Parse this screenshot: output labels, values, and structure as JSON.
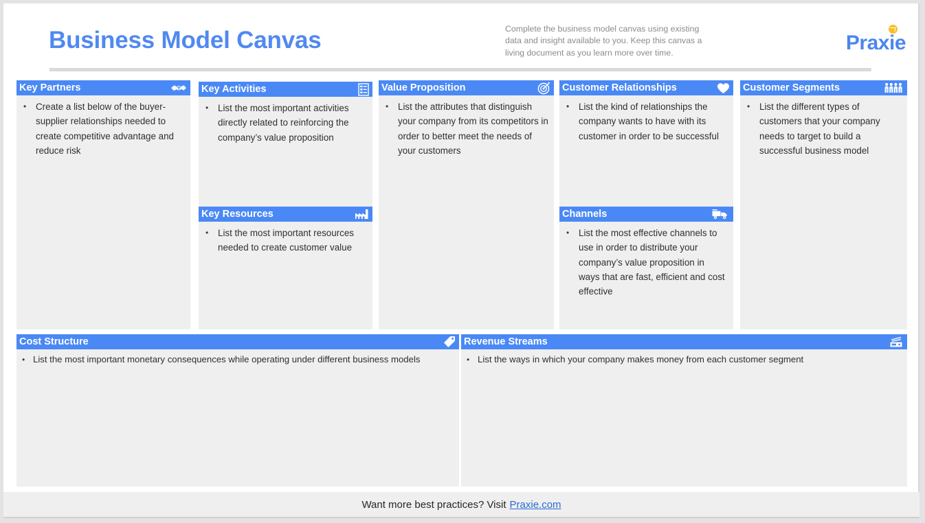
{
  "header": {
    "title": "Business Model Canvas",
    "subtitle": "Complete the business model canvas using existing data and insight available to you. Keep this canvas a living document as you learn more over time.",
    "brand_prefix": "Prax",
    "brand_i": "i",
    "brand_suffix": "e"
  },
  "colors": {
    "accent_blue": "#4a89f5",
    "title_blue": "#5089f0",
    "brand_blue": "#4c86ef",
    "brand_dot_orange": "#fbbf24",
    "panel_body_gray": "#efefef",
    "page_white": "#ffffff",
    "rule_gray": "#d9d9d9",
    "link_blue": "#2a6ad4"
  },
  "panels": [
    {
      "id": "key-partners",
      "title": "Key Partners",
      "icon": "handshake-icon",
      "bullet": "•",
      "text": "Create a list below of the buyer-supplier relationships needed to create competitive advantage and reduce risk"
    },
    {
      "id": "key-activities",
      "title": "Key Activities",
      "icon": "checklist-icon",
      "bullet": "•",
      "text": "List the most important activities directly related to reinforcing the company’s value proposition"
    },
    {
      "id": "key-resources",
      "title": "Key Resources",
      "icon": "factory-icon",
      "bullet": "•",
      "text": "List the most important resources needed to create customer value"
    },
    {
      "id": "value-proposition",
      "title": "Value Proposition",
      "icon": "target-icon",
      "bullet": "•",
      "text": "List the attributes that distinguish your company from its competitors in order to better meet the needs of your customers"
    },
    {
      "id": "customer-relationships",
      "title": "Customer Relationships",
      "icon": "heart-icon",
      "bullet": "•",
      "text": "List the kind of relationships the company wants to have with its customer in order to be successful"
    },
    {
      "id": "channels",
      "title": "Channels",
      "icon": "delivery-truck-icon",
      "bullet": "•",
      "text": "List the most effective channels to use in order to distribute your company’s value proposition in ways that are fast, efficient and cost effective"
    },
    {
      "id": "customer-segments",
      "title": "Customer Segments",
      "icon": "people-group-icon",
      "bullet": "•",
      "text": "List the different types of customers that your company needs to target to build a successful business model"
    },
    {
      "id": "cost-structure",
      "title": "Cost Structure",
      "icon": "price-tag-icon",
      "bullet": "•",
      "text": "List the most important monetary consequences while operating under different business models"
    },
    {
      "id": "revenue-streams",
      "title": "Revenue Streams",
      "icon": "cash-register-icon",
      "bullet": "•",
      "text": "List the ways in which your company makes money from each customer segment"
    }
  ],
  "footer": {
    "text": "Want more best practices? Visit",
    "link": "Praxie.com"
  }
}
